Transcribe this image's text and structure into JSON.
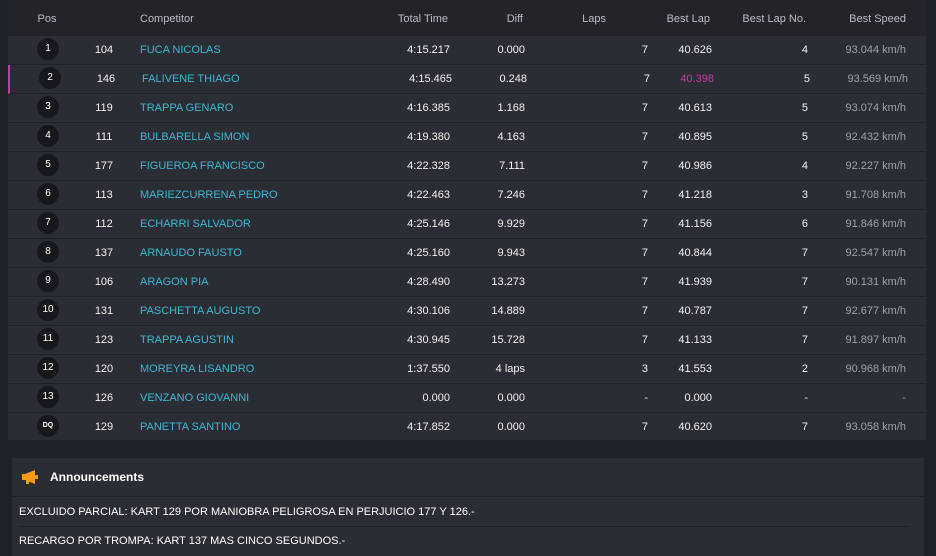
{
  "headers": {
    "pos": "Pos",
    "competitor": "Competitor",
    "total_time": "Total Time",
    "diff": "Diff",
    "laps": "Laps",
    "best_lap": "Best Lap",
    "best_lap_no": "Best Lap No.",
    "best_speed": "Best Speed"
  },
  "rows": [
    {
      "pos": "1",
      "kart": "104",
      "name": "FUCA NICOLAS",
      "total": "4:15.217",
      "diff": "0.000",
      "laps": "7",
      "best": "40.626",
      "blno": "4",
      "speed": "93.044 km/h"
    },
    {
      "pos": "2",
      "kart": "146",
      "name": "FALIVENE THIAGO",
      "total": "4:15.465",
      "diff": "0.248",
      "laps": "7",
      "best": "40.398",
      "blno": "5",
      "speed": "93.569 km/h"
    },
    {
      "pos": "3",
      "kart": "119",
      "name": "TRAPPA GENARO",
      "total": "4:16.385",
      "diff": "1.168",
      "laps": "7",
      "best": "40.613",
      "blno": "5",
      "speed": "93.074 km/h"
    },
    {
      "pos": "4",
      "kart": "111",
      "name": "BULBARELLA SIMON",
      "total": "4:19.380",
      "diff": "4.163",
      "laps": "7",
      "best": "40.895",
      "blno": "5",
      "speed": "92.432 km/h"
    },
    {
      "pos": "5",
      "kart": "177",
      "name": "FIGUEROA FRANCISCO",
      "total": "4:22.328",
      "diff": "7.111",
      "laps": "7",
      "best": "40.986",
      "blno": "4",
      "speed": "92.227 km/h"
    },
    {
      "pos": "6",
      "kart": "113",
      "name": "MARIEZCURRENA PEDRO",
      "total": "4:22.463",
      "diff": "7.246",
      "laps": "7",
      "best": "41.218",
      "blno": "3",
      "speed": "91.708 km/h"
    },
    {
      "pos": "7",
      "kart": "112",
      "name": "ECHARRI SALVADOR",
      "total": "4:25.146",
      "diff": "9.929",
      "laps": "7",
      "best": "41.156",
      "blno": "6",
      "speed": "91.846 km/h"
    },
    {
      "pos": "8",
      "kart": "137",
      "name": "ARNAUDO FAUSTO",
      "total": "4:25.160",
      "diff": "9.943",
      "laps": "7",
      "best": "40.844",
      "blno": "7",
      "speed": "92.547 km/h"
    },
    {
      "pos": "9",
      "kart": "106",
      "name": "ARAGON PIA",
      "total": "4:28.490",
      "diff": "13.273",
      "laps": "7",
      "best": "41.939",
      "blno": "7",
      "speed": "90.131 km/h"
    },
    {
      "pos": "10",
      "kart": "131",
      "name": "PASCHETTA AUGUSTO",
      "total": "4:30.106",
      "diff": "14.889",
      "laps": "7",
      "best": "40.787",
      "blno": "7",
      "speed": "92.677 km/h"
    },
    {
      "pos": "11",
      "kart": "123",
      "name": "TRAPPA AGUSTIN",
      "total": "4:30.945",
      "diff": "15.728",
      "laps": "7",
      "best": "41.133",
      "blno": "7",
      "speed": "91.897 km/h"
    },
    {
      "pos": "12",
      "kart": "120",
      "name": "MOREYRA LISANDRO",
      "total": "1:37.550",
      "diff": "4 laps",
      "laps": "3",
      "best": "41.553",
      "blno": "2",
      "speed": "90.968 km/h"
    },
    {
      "pos": "13",
      "kart": "126",
      "name": "VENZANO GIOVANNI",
      "total": "0.000",
      "diff": "0.000",
      "laps": "-",
      "best": "0.000",
      "blno": "-",
      "speed": "-"
    },
    {
      "pos": "DQ",
      "kart": "129",
      "name": "PANETTA SANTINO",
      "total": "4:17.852",
      "diff": "0.000",
      "laps": "7",
      "best": "40.620",
      "blno": "7",
      "speed": "93.058 km/h"
    }
  ],
  "best_lap_overall_row": 1,
  "colors": {
    "best_lap_highlight": "#c43aa6",
    "competitor_link": "#3bb8d6",
    "announcement_icon": "#f59a1b"
  },
  "announcements": {
    "icon": "megaphone-icon",
    "title": "Announcements",
    "messages": [
      "EXCLUIDO PARCIAL: KART 129 POR MANIOBRA PELIGROSA EN PERJUICIO 177 Y 126.-",
      "RECARGO POR TROMPA: KART 137 MAS CINCO SEGUNDOS.-"
    ]
  }
}
